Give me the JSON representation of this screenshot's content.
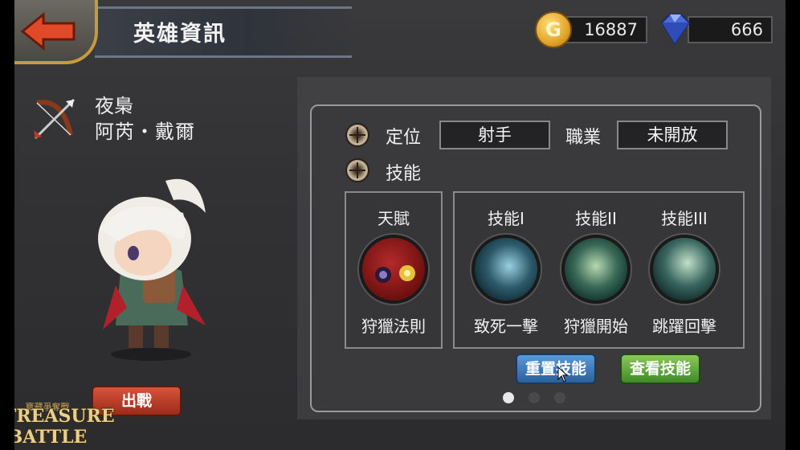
{
  "header": {
    "back_icon": "back-arrow-icon",
    "title": "英雄資訊",
    "gold": "16887",
    "gems": "666",
    "gold_glyph": "G"
  },
  "hero": {
    "class_icon": "bow-icon",
    "title": "夜梟",
    "name": "阿芮・戴爾"
  },
  "info": {
    "role_label": "定位",
    "role_value": "射手",
    "job_label": "職業",
    "job_value": "未開放",
    "skills_label": "技能"
  },
  "talent": {
    "header": "天賦",
    "name": "狩獵法則"
  },
  "skills": [
    {
      "header": "技能I",
      "name": "致死一擊"
    },
    {
      "header": "技能II",
      "name": "狩獵開始"
    },
    {
      "header": "技能III",
      "name": "跳躍回擊"
    }
  ],
  "buttons": {
    "reset": "重置技能",
    "view": "查看技能",
    "deploy": "出戰"
  },
  "pagination": {
    "current": 1,
    "total": 3
  },
  "logo": {
    "line1": "TREASURE",
    "line2": "BATTLE",
    "tagline": "寶藏爭奪戰"
  },
  "colors": {
    "accent_gold": "#c79a3c",
    "reset_blue": "#2a5f9a",
    "view_green": "#3f8a28",
    "deploy_red": "#9c2a1a"
  }
}
